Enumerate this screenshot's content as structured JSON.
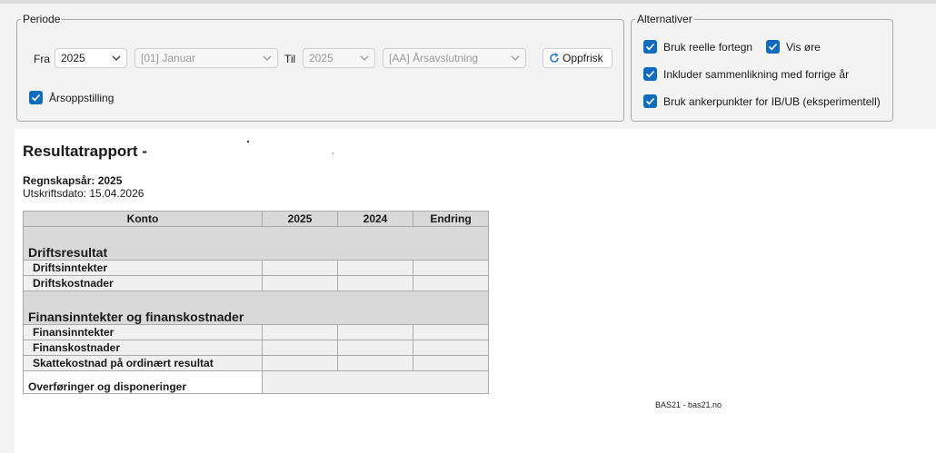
{
  "periode": {
    "legend": "Periode",
    "fra_label": "Fra",
    "fra_year": "2025",
    "fra_month": "[01] Januar",
    "til_label": "Til",
    "til_year": "2025",
    "til_period": "[AA] Årsavslutning",
    "refresh_label": "Oppfrisk",
    "arsoppstilling_label": "Årsoppstilling"
  },
  "alternativer": {
    "legend": "Alternativer",
    "bruk_reelle": "Bruk reelle fortegn",
    "vis_ore": "Vis øre",
    "inkluder": "Inkluder sammenlikning med forrige år",
    "ankerpunkter": "Bruk ankerpunkter for IB/UB (eksperimentell)"
  },
  "report": {
    "title": "Resultatrapport -",
    "regnskapsar": "Regnskapsår: 2025",
    "utskriftsdato": "Utskriftsdato: 15.04.2026",
    "columns": [
      "Konto",
      "2025",
      "2024",
      "Endring"
    ],
    "section1": "Driftsresultat",
    "rows1": [
      "Driftsinntekter",
      "Driftskostnader"
    ],
    "section2": "Finansinntekter og finanskostnader",
    "rows2": [
      "Finansinntekter",
      "Finanskostnader",
      "Skattekostnad på ordinært resultat"
    ],
    "last_row": "Overføringer og disponeringer",
    "footer": "BAS21 - bas21.no"
  },
  "colors": {
    "accent": "#0f6cbd",
    "header_bg": "#d9d9d9",
    "row_bg": "#f0f0f0"
  }
}
